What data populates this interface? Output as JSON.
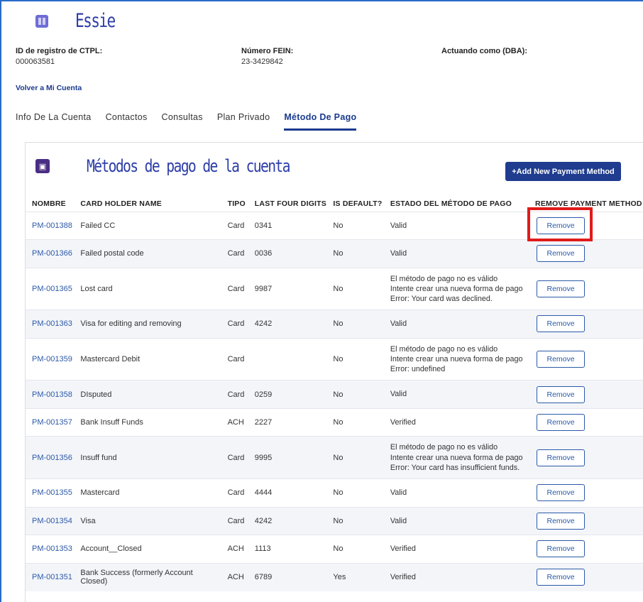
{
  "account": {
    "name": "Essie",
    "ctpl_label": "ID de registro de CTPL:",
    "ctpl_value": "000063581",
    "fein_label": "Número FEIN:",
    "fein_value": "23-3429842",
    "dba_label": "Actuando como (DBA):",
    "back_link": "Volver a Mi Cuenta"
  },
  "tabs": [
    {
      "label": "Info De La Cuenta",
      "active": false
    },
    {
      "label": "Contactos",
      "active": false
    },
    {
      "label": "Consultas",
      "active": false
    },
    {
      "label": "Plan Privado",
      "active": false
    },
    {
      "label": "Método De Pago",
      "active": true
    }
  ],
  "panel": {
    "title": "Métodos de pago de la cuenta",
    "add_label": "+Add New Payment Method"
  },
  "table": {
    "headers": [
      "NOMBRE",
      "CARD HOLDER NAME",
      "TIPO",
      "LAST FOUR DIGITS",
      "IS DEFAULT?",
      "ESTADO DEL MÉTODO DE PAGO",
      "REMOVE PAYMENT METHOD"
    ],
    "remove_label": "Remove",
    "rows": [
      {
        "id": "PM-001388",
        "holder": "Failed CC",
        "type": "Card",
        "last4": "0341",
        "default": "No",
        "status": [
          "Valid"
        ]
      },
      {
        "id": "PM-001366",
        "holder": "Failed postal code",
        "type": "Card",
        "last4": "0036",
        "default": "No",
        "status": [
          "Valid"
        ]
      },
      {
        "id": "PM-001365",
        "holder": "Lost card",
        "type": "Card",
        "last4": "9987",
        "default": "No",
        "status": [
          "El método de pago no es válido",
          "Intente crear una nueva forma de pago",
          "Error: Your card was declined."
        ]
      },
      {
        "id": "PM-001363",
        "holder": "Visa for editing and removing",
        "type": "Card",
        "last4": "4242",
        "default": "No",
        "status": [
          "Valid"
        ]
      },
      {
        "id": "PM-001359",
        "holder": "Mastercard Debit",
        "type": "Card",
        "last4": "",
        "default": "No",
        "status": [
          "El método de pago no es válido",
          "Intente crear una nueva forma de pago",
          "Error: undefined"
        ]
      },
      {
        "id": "PM-001358",
        "holder": "DIsputed",
        "type": "Card",
        "last4": "0259",
        "default": "No",
        "status": [
          "Valid"
        ]
      },
      {
        "id": "PM-001357",
        "holder": "Bank Insuff Funds",
        "type": "ACH",
        "last4": "2227",
        "default": "No",
        "status": [
          "Verified"
        ]
      },
      {
        "id": "PM-001356",
        "holder": "Insuff fund",
        "type": "Card",
        "last4": "9995",
        "default": "No",
        "status": [
          "El método de pago no es válido",
          "Intente crear una nueva forma de pago",
          "Error: Your card has insufficient funds."
        ]
      },
      {
        "id": "PM-001355",
        "holder": "Mastercard",
        "type": "Card",
        "last4": "4444",
        "default": "No",
        "status": [
          "Valid"
        ]
      },
      {
        "id": "PM-001354",
        "holder": "Visa",
        "type": "Card",
        "last4": "4242",
        "default": "No",
        "status": [
          "Valid"
        ]
      },
      {
        "id": "PM-001353",
        "holder": "Account__Closed",
        "type": "ACH",
        "last4": "1113",
        "default": "No",
        "status": [
          "Verified"
        ]
      },
      {
        "id": "PM-001351",
        "holder": "Bank Success (formerly Account Closed)",
        "type": "ACH",
        "last4": "6789",
        "default": "Yes",
        "status": [
          "Verified"
        ]
      }
    ]
  },
  "colors": {
    "accent": "#1f3c8f",
    "link": "#2d5aa8",
    "highlight": "#e01b1b"
  }
}
